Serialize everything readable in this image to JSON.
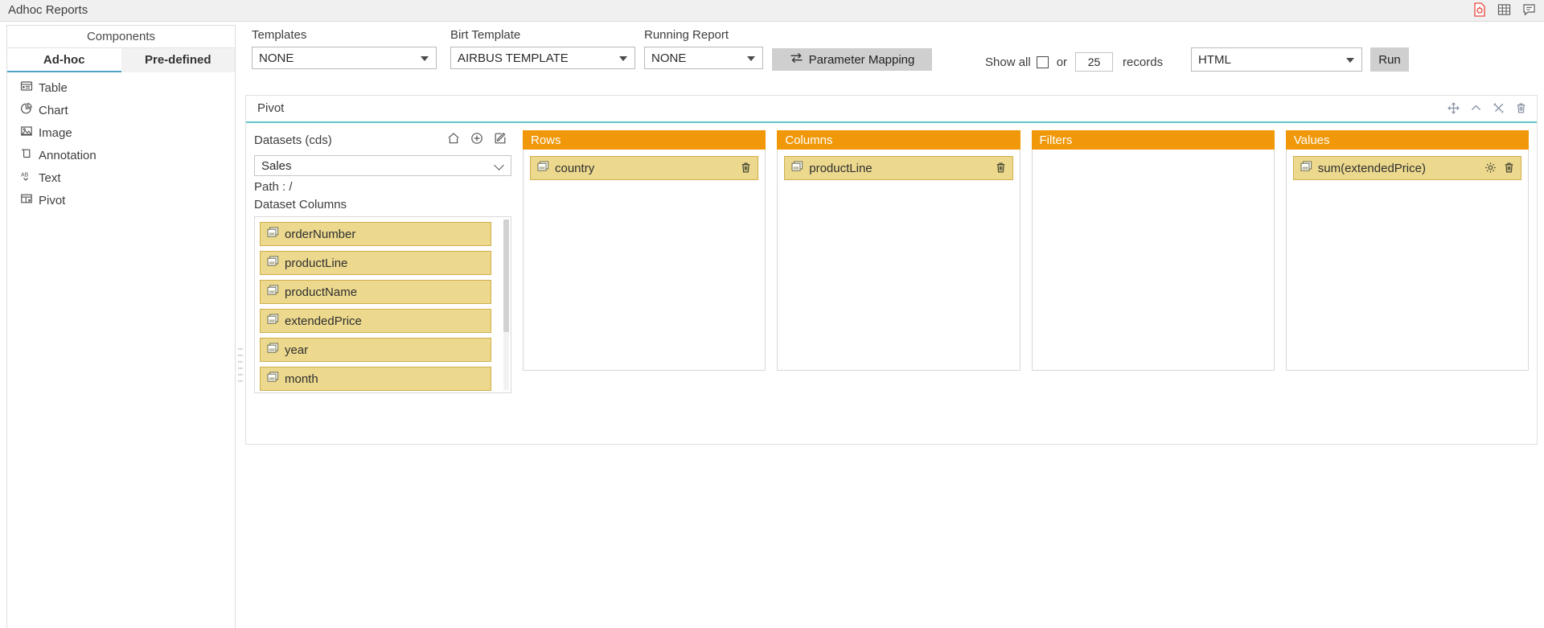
{
  "app": {
    "title": "Adhoc Reports",
    "titlebar_icons": [
      {
        "name": "report-settings-icon",
        "label": "report-settings"
      },
      {
        "name": "grid-table-icon",
        "label": "grid-table"
      },
      {
        "name": "comment-icon",
        "label": "comment"
      }
    ]
  },
  "colors": {
    "accent_orange": "#f0980a",
    "pill_yellow": "#ecd98e",
    "pill_border": "#cfae4a",
    "teal_underline": "#63c3c9",
    "button_grey": "#cfcfcf",
    "red_icon": "#e8453c"
  },
  "components": {
    "header": "Components",
    "tabs": [
      {
        "label": "Ad-hoc",
        "active": true
      },
      {
        "label": "Pre-defined",
        "active": false
      }
    ],
    "items": [
      {
        "label": "Table",
        "icon": "table-icon"
      },
      {
        "label": "Chart",
        "icon": "pie-chart-icon"
      },
      {
        "label": "Image",
        "icon": "image-icon"
      },
      {
        "label": "Annotation",
        "icon": "annotation-icon"
      },
      {
        "label": "Text",
        "icon": "text-ab-icon"
      },
      {
        "label": "Pivot",
        "icon": "pivot-icon"
      }
    ]
  },
  "toolbar": {
    "templates": {
      "label": "Templates",
      "value": "NONE"
    },
    "birt_template": {
      "label": "Birt Template",
      "value": "AIRBUS TEMPLATE"
    },
    "running_report": {
      "label": "Running Report",
      "value": "NONE"
    },
    "parameter_mapping": {
      "label": "Parameter Mapping",
      "icon": "swap-arrows-icon"
    },
    "show_all": {
      "label": "Show all",
      "checked": false
    },
    "or_label": "or",
    "records_value": "25",
    "records_label": "records",
    "format": {
      "value": "HTML"
    },
    "run": {
      "label": "Run"
    }
  },
  "pivot": {
    "title": "Pivot",
    "header_icons": [
      {
        "name": "move-icon"
      },
      {
        "name": "chevron-up-icon"
      },
      {
        "name": "tools-icon"
      },
      {
        "name": "trash-icon"
      }
    ],
    "datasets": {
      "label": "Datasets (cds)",
      "icons": [
        {
          "name": "home-icon"
        },
        {
          "name": "plus-circle-icon"
        },
        {
          "name": "edit-pencil-icon"
        }
      ],
      "selected": "Sales",
      "path_label": "Path : /",
      "columns_label": "Dataset Columns",
      "columns": [
        {
          "label": "orderNumber",
          "icon": "column-icon"
        },
        {
          "label": "productLine",
          "icon": "column-icon"
        },
        {
          "label": "productName",
          "icon": "column-icon"
        },
        {
          "label": "extendedPrice",
          "icon": "column-icon"
        },
        {
          "label": "year",
          "icon": "column-icon"
        },
        {
          "label": "month",
          "icon": "column-icon"
        }
      ]
    },
    "zones": [
      {
        "title": "Rows",
        "items": [
          {
            "label": "country",
            "icon": "column-icon",
            "has_settings": false,
            "has_delete": true
          }
        ]
      },
      {
        "title": "Columns",
        "items": [
          {
            "label": "productLine",
            "icon": "column-icon",
            "has_settings": false,
            "has_delete": true
          }
        ]
      },
      {
        "title": "Filters",
        "items": []
      },
      {
        "title": "Values",
        "items": [
          {
            "label": "sum(extendedPrice)",
            "icon": "column-icon",
            "has_settings": true,
            "has_delete": true
          }
        ]
      }
    ]
  }
}
